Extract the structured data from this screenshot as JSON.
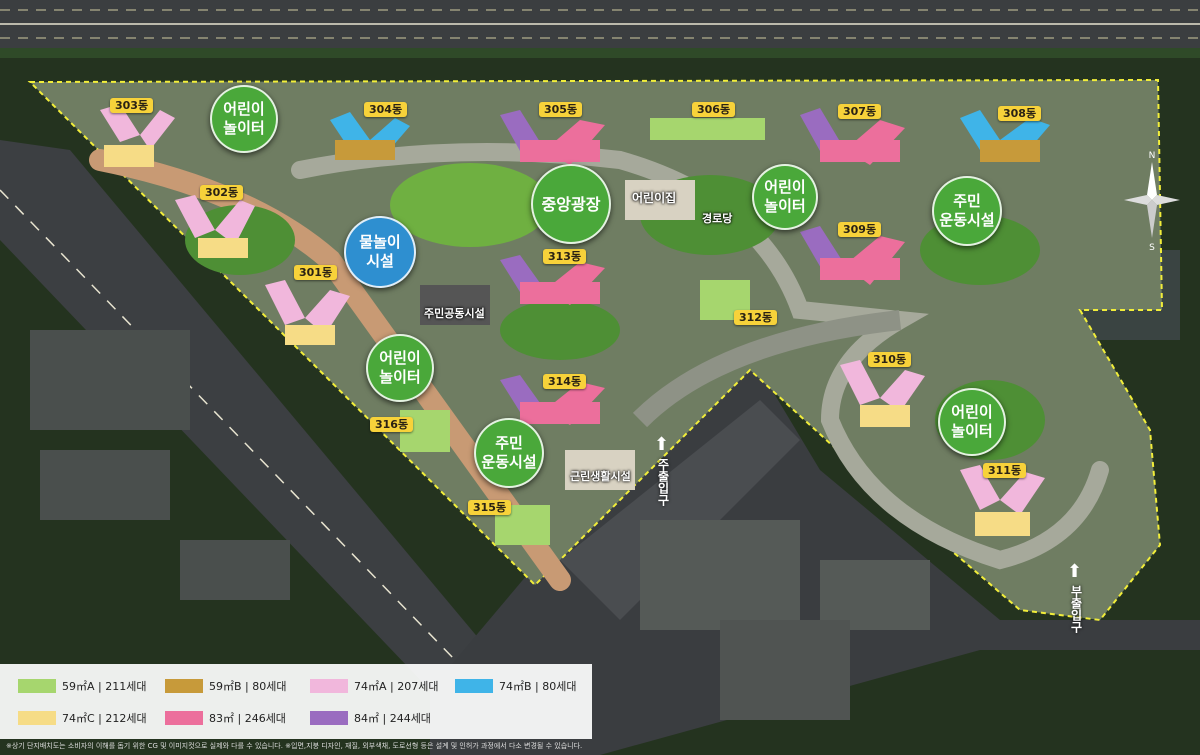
{
  "dongs": [
    "303동",
    "304동",
    "305동",
    "306동",
    "307동",
    "308동",
    "302동",
    "313동",
    "309동",
    "301동",
    "312동",
    "310동",
    "314동",
    "316동",
    "311동",
    "315동"
  ],
  "amenities": {
    "playground": "어린이\n놀이터",
    "water_play": "물놀이\n시설",
    "central_plaza": "중앙광장",
    "fitness": "주민\n운동시설"
  },
  "facilities": {
    "daycare": "어린이집",
    "senior_center": "경로당",
    "community": "주민공동시설",
    "retail": "근린생활시설"
  },
  "entrances": {
    "main": "주출입구",
    "sub": "부출입구"
  },
  "legend": [
    {
      "label": "59㎡A | 211세대",
      "color": "#a6d66e"
    },
    {
      "label": "59㎡B | 80세대",
      "color": "#c79a3a"
    },
    {
      "label": "74㎡A | 207세대",
      "color": "#f1b7dc"
    },
    {
      "label": "74㎡B | 80세대",
      "color": "#3fb4e8"
    },
    {
      "label": "74㎡C | 212세대",
      "color": "#f6dc86"
    },
    {
      "label": "83㎡ | 246세대",
      "color": "#ec6f9c"
    },
    {
      "label": "84㎡ | 244세대",
      "color": "#9a6cc0"
    }
  ],
  "disclaimer": "※상기 단지배치도는 소비자의 이해를 돕기 위한 CG 및 이미지컷으로 실제와 다를 수 있습니다. ※입면,지붕 디자인, 재질, 외부색채, 도로선형 등은 설계 및 인허가 과정에서 다소 변경될 수 있습니다."
}
